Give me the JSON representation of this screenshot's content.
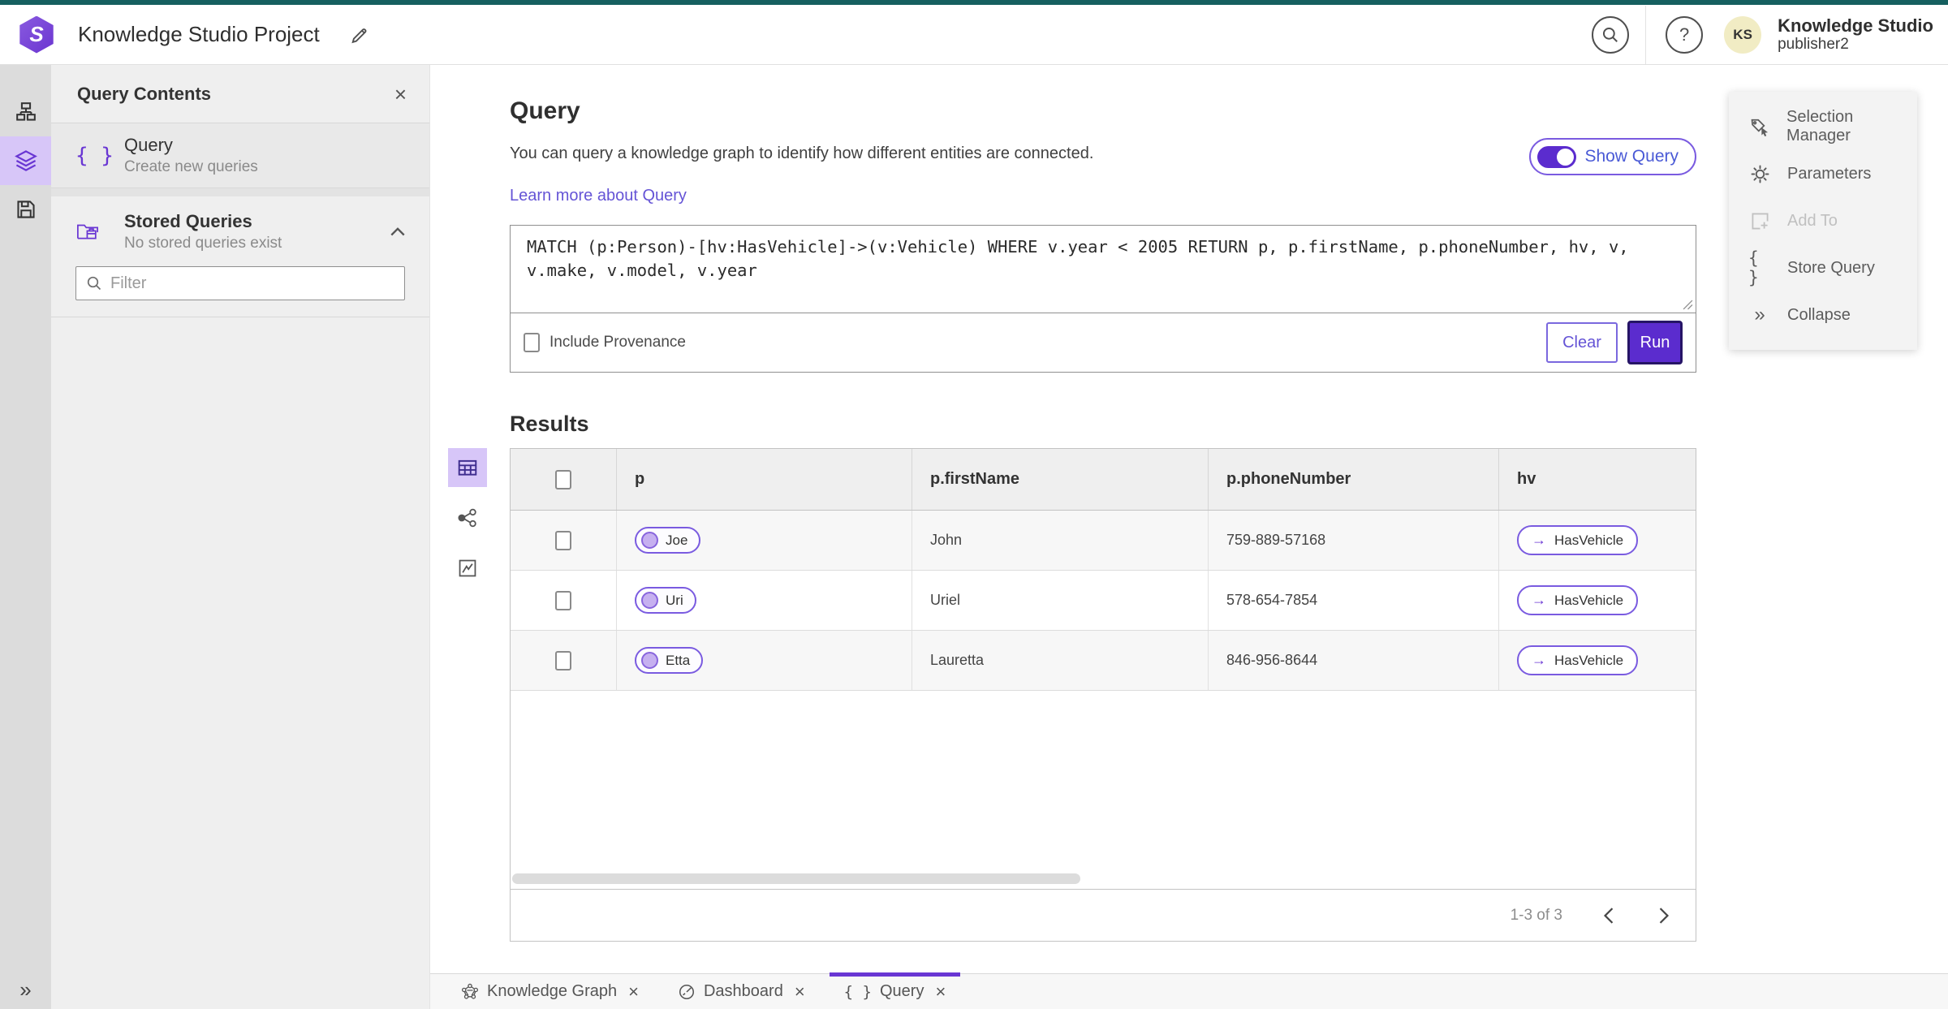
{
  "topbar": {
    "title": "Knowledge Studio Project",
    "user_name": "Knowledge Studio",
    "user_role": "publisher2",
    "avatar_initials": "KS"
  },
  "sidebar": {
    "panel_title": "Query Contents",
    "query_item_title": "Query",
    "query_item_subtitle": "Create new queries",
    "stored_title": "Stored Queries",
    "stored_subtitle": "No stored queries exist",
    "filter_placeholder": "Filter"
  },
  "main": {
    "title": "Query",
    "description": "You can query a knowledge graph to identify how different entities are connected.",
    "learn_more": "Learn more about Query",
    "show_query_label": "Show Query",
    "query_text": "MATCH (p:Person)-[hv:HasVehicle]->(v:Vehicle) WHERE v.year < 2005 RETURN p, p.firstName, p.phoneNumber, hv, v, v.make, v.model, v.year",
    "include_provenance_label": "Include Provenance",
    "clear_label": "Clear",
    "run_label": "Run",
    "results_title": "Results"
  },
  "table": {
    "columns": [
      "p",
      "p.firstName",
      "p.phoneNumber",
      "hv"
    ],
    "rows": [
      {
        "p": "Joe",
        "firstName": "John",
        "phoneNumber": "759-889-57168",
        "hv": "HasVehicle"
      },
      {
        "p": "Uri",
        "firstName": "Uriel",
        "phoneNumber": "578-654-7854",
        "hv": "HasVehicle"
      },
      {
        "p": "Etta",
        "firstName": "Lauretta",
        "phoneNumber": "846-956-8644",
        "hv": "HasVehicle"
      }
    ],
    "pagination": "1-3 of 3"
  },
  "right_panel": {
    "items": [
      {
        "label": "Selection Manager",
        "disabled": false
      },
      {
        "label": "Parameters",
        "disabled": false
      },
      {
        "label": "Add To",
        "disabled": true
      },
      {
        "label": "Store Query",
        "disabled": false
      },
      {
        "label": "Collapse",
        "disabled": false
      }
    ]
  },
  "tabs": {
    "items": [
      {
        "label": "Knowledge Graph"
      },
      {
        "label": "Dashboard"
      },
      {
        "label": "Query"
      }
    ]
  },
  "icons": {
    "close": "×",
    "braces": "{ }",
    "arrow_right": "→",
    "collapse_chevrons": "»",
    "question_mark": "?"
  },
  "colors": {
    "teal_strip": "#166060",
    "accent_purple": "#6936d3",
    "run_fill": "#5b2cce",
    "lavender_highlight": "#d7c6f8",
    "link": "#6554d6",
    "toggle_label": "#4a5ad6"
  }
}
